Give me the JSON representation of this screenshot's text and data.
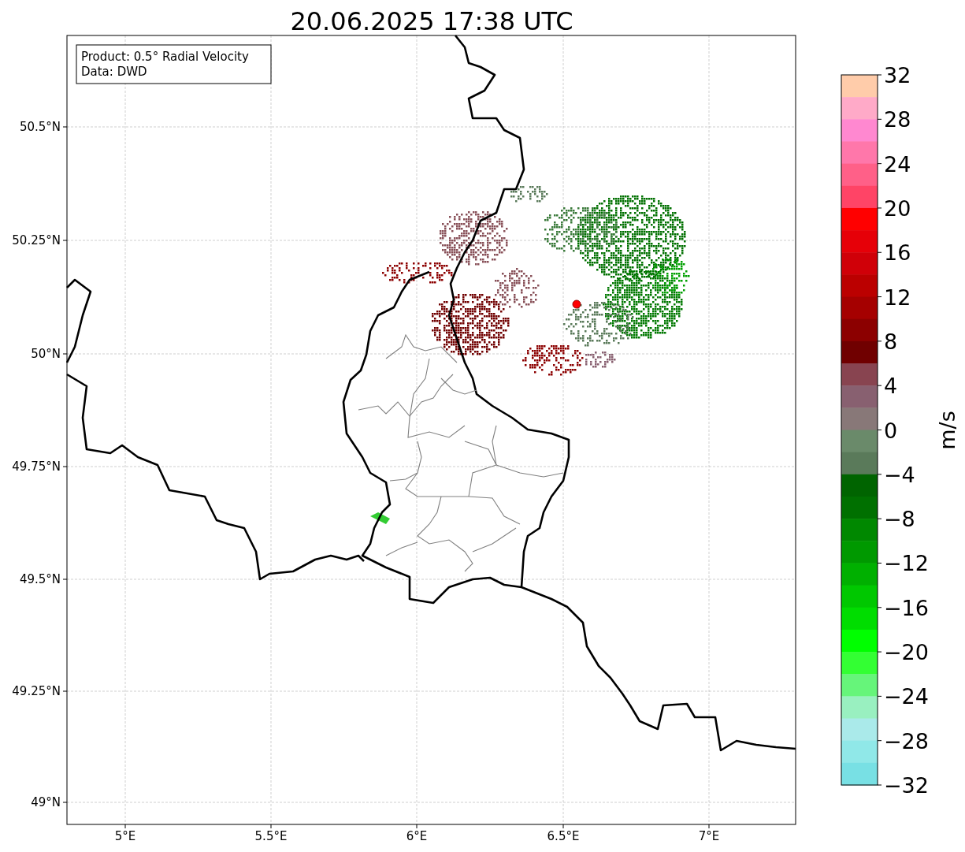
{
  "title": "20.06.2025 17:38 UTC",
  "info_box": {
    "lines": [
      "Product: 0.5° Radial Velocity",
      "Data: DWD"
    ]
  },
  "map": {
    "x_ticks": [
      "5°E",
      "5.5°E",
      "6°E",
      "6.5°E",
      "7°E"
    ],
    "y_ticks": [
      "50.5°N",
      "50.25°N",
      "50°N",
      "49.75°N",
      "49.5°N",
      "49.25°N",
      "49°N"
    ]
  },
  "colorbar": {
    "label": "m/s",
    "ticks": [
      "32",
      "28",
      "24",
      "20",
      "16",
      "12",
      "8",
      "4",
      "0",
      "−4",
      "−8",
      "−12",
      "−16",
      "−20",
      "−24",
      "−28",
      "−32"
    ],
    "segments": [
      {
        "color": "#ffccaa"
      },
      {
        "color": "#ffaac8"
      },
      {
        "color": "#ff88d0"
      },
      {
        "color": "#ff77aa"
      },
      {
        "color": "#ff6088"
      },
      {
        "color": "#ff4466"
      },
      {
        "color": "#ff0000"
      },
      {
        "color": "#e60008"
      },
      {
        "color": "#d00008"
      },
      {
        "color": "#bb0000"
      },
      {
        "color": "#a50000"
      },
      {
        "color": "#8c0000"
      },
      {
        "color": "#700000"
      },
      {
        "color": "#884450"
      },
      {
        "color": "#886070"
      },
      {
        "color": "#887878"
      },
      {
        "color": "#6a8a6a"
      },
      {
        "color": "#5a7a5a"
      },
      {
        "color": "#006400"
      },
      {
        "color": "#007000"
      },
      {
        "color": "#008800"
      },
      {
        "color": "#009900"
      },
      {
        "color": "#00b000"
      },
      {
        "color": "#00c800"
      },
      {
        "color": "#00dd00"
      },
      {
        "color": "#00ff00"
      },
      {
        "color": "#33ff33"
      },
      {
        "color": "#66f57a"
      },
      {
        "color": "#99f0c0"
      },
      {
        "color": "#aaeaea"
      },
      {
        "color": "#90e8e8"
      },
      {
        "color": "#78e0e4"
      }
    ]
  }
}
